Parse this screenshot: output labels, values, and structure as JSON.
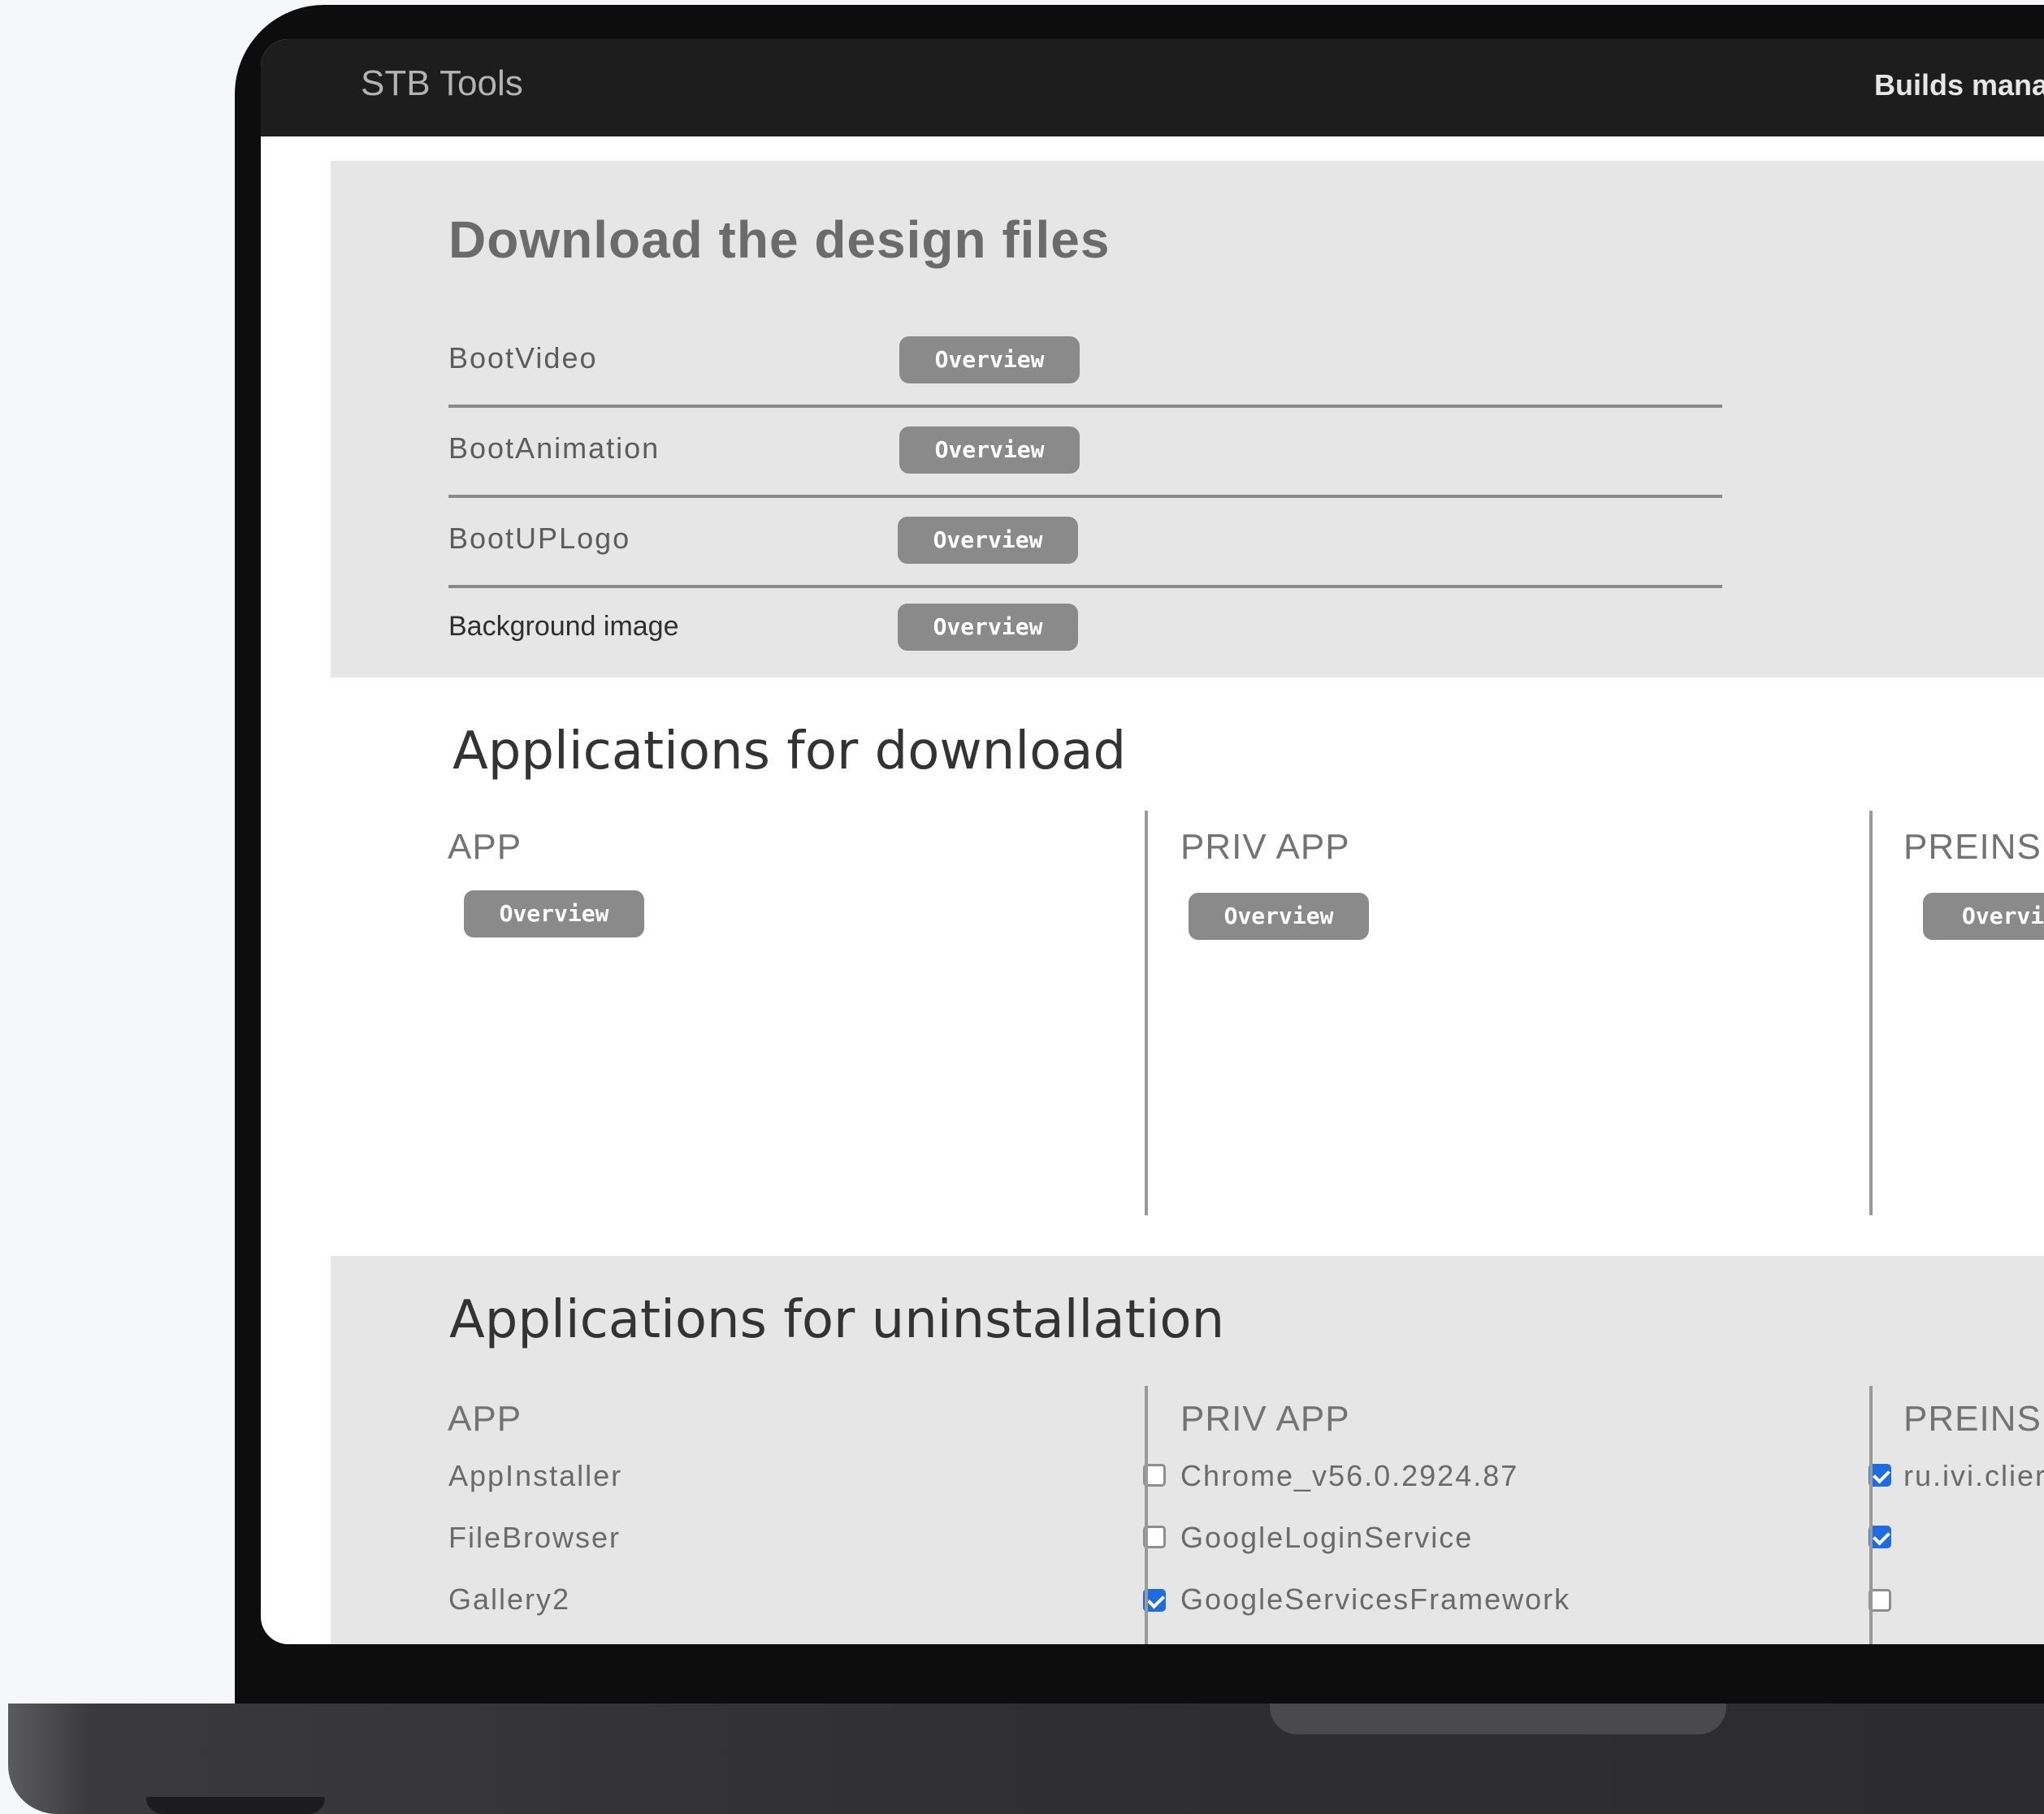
{
  "header": {
    "brand": "STB Tools",
    "nav_label": "Builds mana"
  },
  "design_files": {
    "title": "Download the design files",
    "rows": [
      {
        "label": "BootVideo",
        "button": "Overview"
      },
      {
        "label": "BootAnimation",
        "button": "Overview"
      },
      {
        "label": "BootUPLogo",
        "button": "Overview"
      },
      {
        "label": "Background image",
        "button": "Overview"
      }
    ]
  },
  "apps_download": {
    "title": "Applications for download",
    "columns": [
      {
        "title": "APP",
        "button": "Overview"
      },
      {
        "title": "PRIV APP",
        "button": "Overview"
      },
      {
        "title": "PREINS",
        "button": "Overvie"
      }
    ]
  },
  "apps_uninstall": {
    "title": "Applications for uninstallation",
    "columns": [
      {
        "title": "APP",
        "items": [
          {
            "name": "AppInstaller",
            "checked": false
          },
          {
            "name": "FileBrowser",
            "checked": false
          },
          {
            "name": "Gallery2",
            "checked": true
          }
        ]
      },
      {
        "title": "PRIV APP",
        "items": [
          {
            "name": "Chrome_v56.0.2924.87",
            "checked": true
          },
          {
            "name": "GoogleLoginService",
            "checked": true
          },
          {
            "name": "GoogleServicesFramework",
            "checked": false
          }
        ]
      },
      {
        "title": "PREINS",
        "items": [
          {
            "name": "ru.ivi.clier"
          }
        ]
      }
    ]
  },
  "colors": {
    "topbar": "#1d1d1d",
    "panel": "#e6e6e6",
    "button": "#8a8a8a",
    "checkbox_checked": "#1f6be0"
  }
}
